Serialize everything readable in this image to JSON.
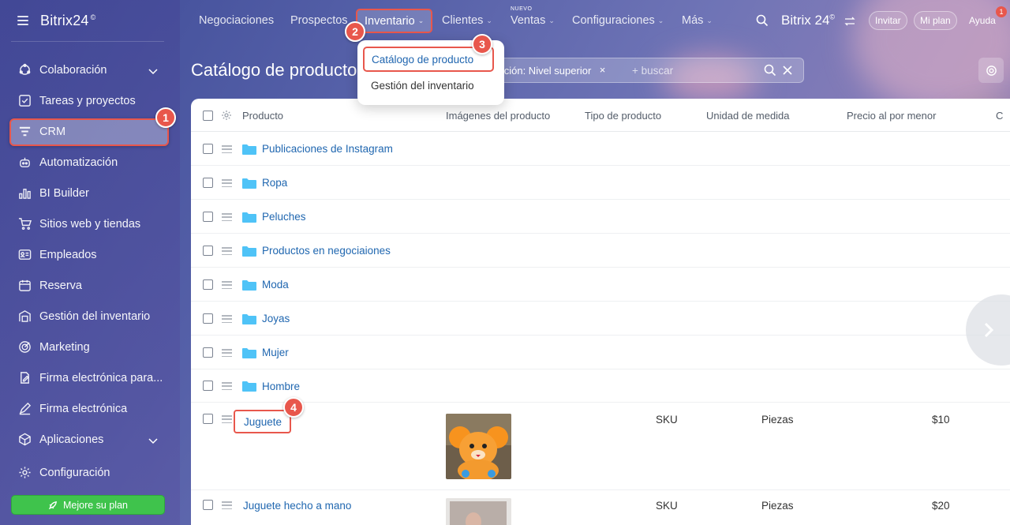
{
  "sidebar": {
    "logo": "Bitrix24",
    "logo_mark": "©",
    "items": [
      {
        "label": "Colaboración",
        "icon": "collaboration-icon",
        "has_chevron": true
      },
      {
        "label": "Tareas y proyectos",
        "icon": "tasks-icon"
      },
      {
        "label": "CRM",
        "icon": "crm-funnel-icon",
        "active": true
      },
      {
        "label": "Automatización",
        "icon": "robot-icon"
      },
      {
        "label": "BI Builder",
        "icon": "bar-chart-icon"
      },
      {
        "label": "Sitios web y tiendas",
        "icon": "cart-icon"
      },
      {
        "label": "Empleados",
        "icon": "id-card-icon"
      },
      {
        "label": "Reserva",
        "icon": "calendar-icon"
      },
      {
        "label": "Gestión del inventario",
        "icon": "warehouse-icon"
      },
      {
        "label": "Marketing",
        "icon": "target-icon"
      },
      {
        "label": "Firma electrónica para...",
        "icon": "document-sign-icon"
      },
      {
        "label": "Firma electrónica",
        "icon": "pen-icon"
      },
      {
        "label": "Aplicaciones",
        "icon": "cube-icon",
        "has_chevron": true
      },
      {
        "label": "Configuración",
        "icon": "gear-icon"
      }
    ],
    "upgrade_label": "Mejore su plan"
  },
  "topnav": {
    "items": [
      {
        "label": "Negociaciones"
      },
      {
        "label": "Prospectos"
      },
      {
        "label": "Inventario",
        "dropdown": true,
        "active": true
      },
      {
        "label": "Clientes",
        "dropdown": true
      },
      {
        "label": "Ventas",
        "dropdown": true,
        "badge": "NUEVO"
      },
      {
        "label": "Configuraciones",
        "dropdown": true
      },
      {
        "label": "Más",
        "dropdown": true
      }
    ],
    "brand": "Bitrix 24",
    "brand_mark": "©",
    "invite": "Invitar",
    "plan": "Mi plan",
    "help": "Ayuda",
    "notification_count": "1"
  },
  "dropdown": {
    "items": [
      "Catálogo de producto",
      "Gestión del inventario"
    ]
  },
  "markers": [
    "1",
    "2",
    "3",
    "4"
  ],
  "page": {
    "title": "Catálogo de producto",
    "filter_tag": "ección: Nivel superior",
    "search_placeholder": "+ buscar"
  },
  "table": {
    "columns": [
      "Producto",
      "Imágenes del producto",
      "Tipo de producto",
      "Unidad de medida",
      "Precio al por menor",
      "C"
    ],
    "folders": [
      "Publicaciones de Instagram",
      "Ropa",
      "Peluches",
      "Productos en negociaiones",
      "Moda",
      "Joyas",
      "Mujer",
      "Hombre"
    ],
    "products": [
      {
        "name": "Juguete",
        "type": "SKU",
        "unit": "Piezas",
        "price": "$10"
      },
      {
        "name": "Juguete hecho a mano",
        "type": "SKU",
        "unit": "Piezas",
        "price": "$20"
      }
    ]
  },
  "colors": {
    "accent": "#e8574c",
    "link": "#2067b0",
    "upgrade": "#3fc34c",
    "folder": "#4fc3f7"
  }
}
